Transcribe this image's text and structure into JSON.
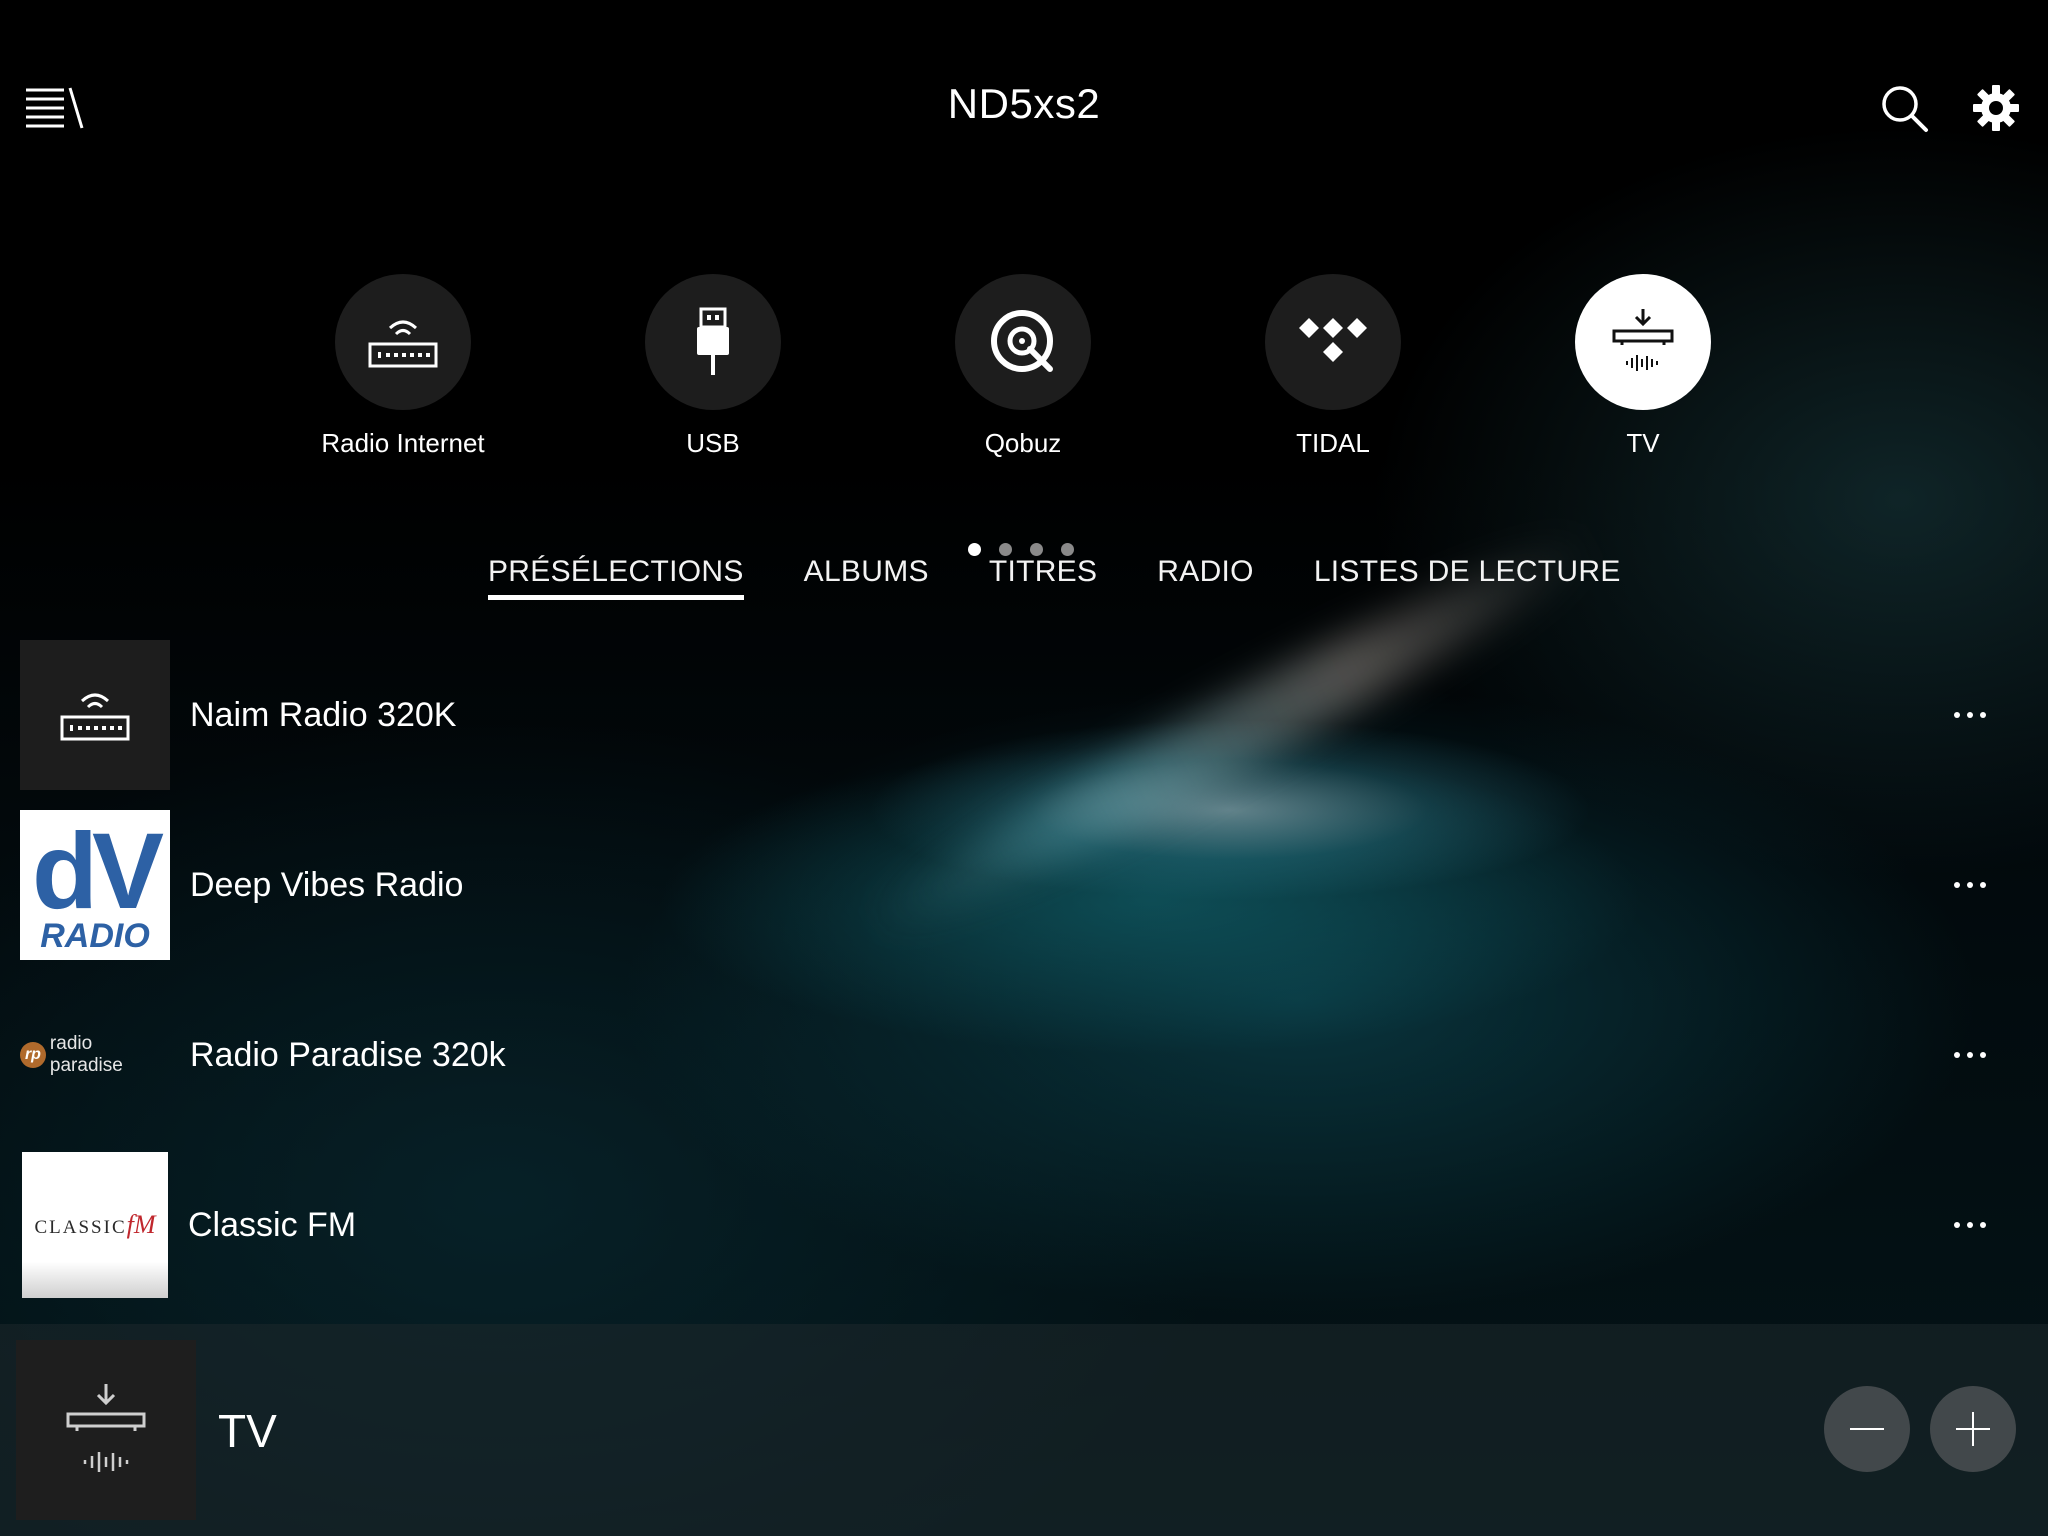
{
  "header": {
    "title": "ND5xs2",
    "menu_icon": "menu-icon",
    "search_icon": "search-icon",
    "settings_icon": "gear-icon"
  },
  "sources": [
    {
      "label": "Radio Internet",
      "icon": "router-wifi-icon",
      "active": false
    },
    {
      "label": "USB",
      "icon": "usb-icon",
      "active": false
    },
    {
      "label": "Qobuz",
      "icon": "qobuz-icon",
      "active": false
    },
    {
      "label": "TIDAL",
      "icon": "tidal-icon",
      "active": false
    },
    {
      "label": "TV",
      "icon": "tv-input-icon",
      "active": true
    }
  ],
  "pager": {
    "pages": 4,
    "current": 1
  },
  "tabs": [
    {
      "label": "PRÉSÉLECTIONS",
      "active": true
    },
    {
      "label": "ALBUMS",
      "active": false
    },
    {
      "label": "TITRES",
      "active": false
    },
    {
      "label": "RADIO",
      "active": false
    },
    {
      "label": "LISTES DE LECTURE",
      "active": false
    }
  ],
  "presets": [
    {
      "name": "Naim Radio 320K",
      "thumb": "router-wifi-icon"
    },
    {
      "name": "Deep Vibes Radio",
      "thumb_text_big": "dV",
      "thumb_text_small": "RADIO"
    },
    {
      "name": "Radio Paradise 320k",
      "thumb_badge": "rp",
      "thumb_text": "radio paradise"
    },
    {
      "name": "Classic FM",
      "thumb_text": "CLASSIC",
      "thumb_accent": "fM"
    }
  ],
  "now_playing": {
    "title": "TV",
    "icon": "tv-input-icon",
    "volume_down_icon": "minus-icon",
    "volume_up_icon": "plus-icon"
  },
  "colors": {
    "background": "#000000",
    "tile": "#1d1d1d",
    "accent_active": "#ffffff",
    "dv_blue": "#2d61a5",
    "cfm_red": "#c0272d"
  }
}
